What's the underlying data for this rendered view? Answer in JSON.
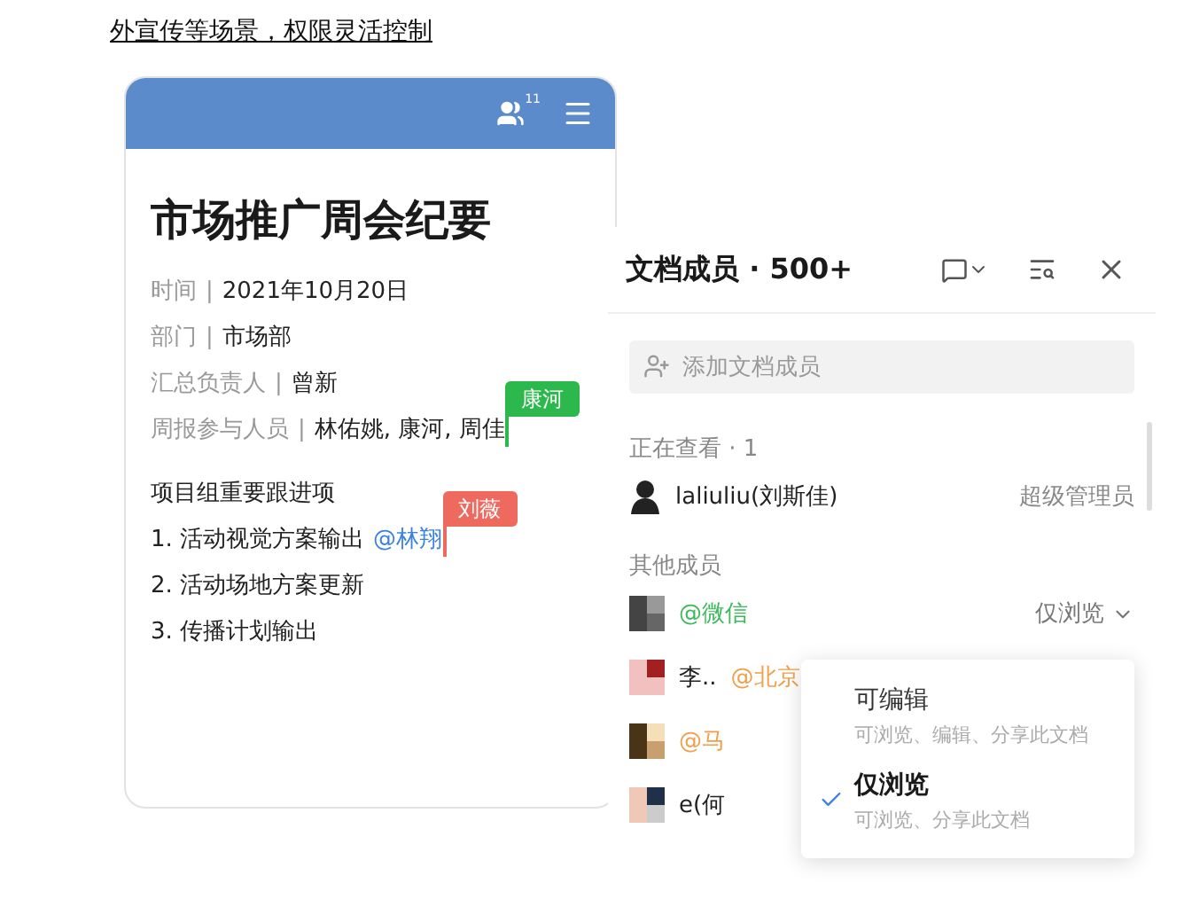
{
  "caption": "外宣传等场景，权限灵活控制",
  "doc": {
    "member_count": "11",
    "title": "市场推广周会纪要",
    "fields": [
      {
        "label": "时间",
        "separator": "|",
        "value": "2021年10月20日"
      },
      {
        "label": "部门",
        "separator": "|",
        "value": "市场部"
      },
      {
        "label": "汇总负责人",
        "separator": "|",
        "value": "曾新"
      },
      {
        "label": "周报参与人员",
        "separator": "|",
        "value": "林佑姚, 康河, 周佳",
        "cursor": {
          "name": "康河",
          "color": "#2db84d"
        }
      }
    ],
    "section": "项目组重要跟进项",
    "items": [
      {
        "text": "1. 活动视觉方案输出",
        "mention": "@林翔",
        "cursor": {
          "name": "刘薇",
          "color": "#ee6a5f"
        }
      },
      {
        "text": "2. 活动场地方案更新"
      },
      {
        "text": "3. 传播计划输出"
      }
    ]
  },
  "panel": {
    "title": "文档成员 · 500+",
    "search": {
      "placeholder": "添加文档成员"
    },
    "viewing_label": "正在查看 · 1",
    "viewers": [
      {
        "name": "laliuliu(刘斯佳)",
        "role": "超级管理员"
      }
    ],
    "others_label": "其他成员",
    "members": [
      {
        "tag": "@微信",
        "color": "#3cb95a",
        "permission": "仅浏览"
      },
      {
        "name": "李..",
        "tag": "@北京",
        "color": "#f0a04b"
      },
      {
        "tag": "@马",
        "color": "#f0a04b"
      },
      {
        "name": "e(何"
      }
    ],
    "menu": {
      "options": [
        {
          "label": "可编辑",
          "description": "可浏览、编辑、分享此文档",
          "selected": false
        },
        {
          "label": "仅浏览",
          "description": "可浏览、分享此文档",
          "selected": true
        }
      ]
    }
  }
}
